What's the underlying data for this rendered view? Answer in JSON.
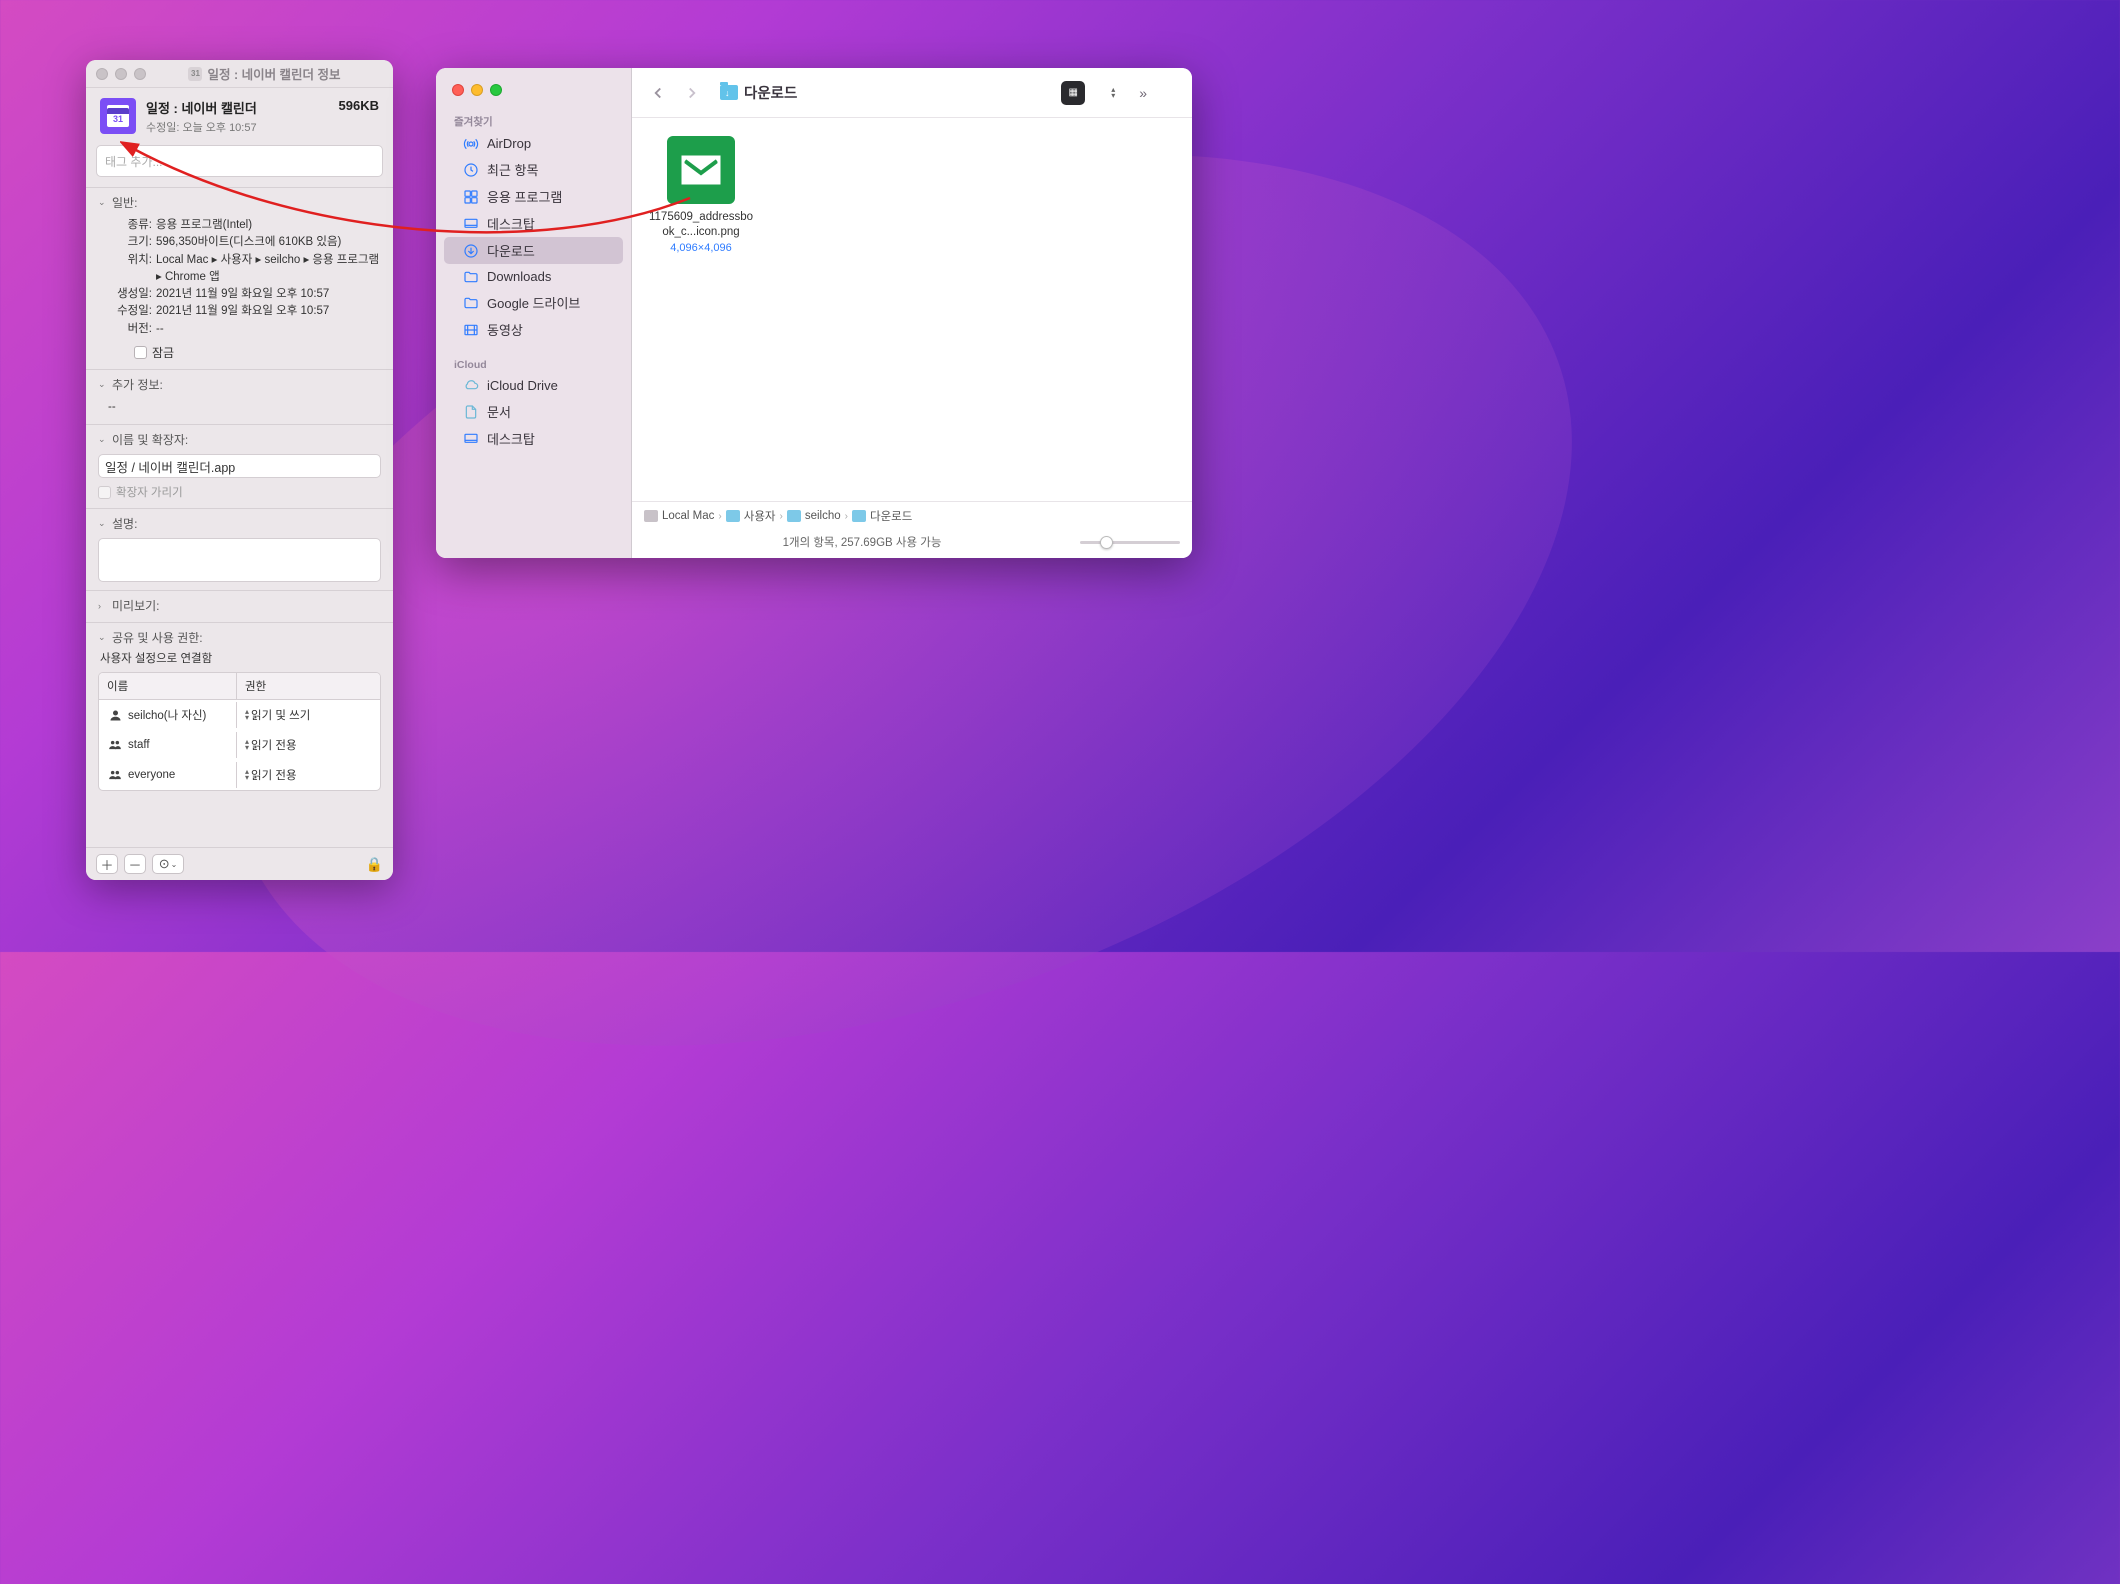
{
  "info": {
    "window_title": "일정 : 네이버 캘린더 정보",
    "app_name": "일정 : 네이버 캘린더",
    "modified_label": "수정일: 오늘 오후 10:57",
    "size": "596KB",
    "tag_placeholder": "태그 추가...",
    "icon_day": "31",
    "sections": {
      "general": {
        "title": "일반:",
        "kind_label": "종류:",
        "kind": "응용 프로그램(Intel)",
        "size_label": "크기:",
        "size": "596,350바이트(디스크에 610KB 있음)",
        "where_label": "위치:",
        "where": "Local Mac ▸ 사용자 ▸ seilcho ▸ 응용 프로그램 ▸ Chrome 앱",
        "created_label": "생성일:",
        "created": "2021년 11월 9일 화요일 오후 10:57",
        "modified_label": "수정일:",
        "modified": "2021년 11월 9일 화요일 오후 10:57",
        "version_label": "버전:",
        "version": "--",
        "locked_label": "잠금"
      },
      "more": {
        "title": "추가 정보:",
        "content": "--"
      },
      "name_ext": {
        "title": "이름 및 확장자:",
        "value": "일정 / 네이버 캘린더.app",
        "hide_ext": "확장자 가리기"
      },
      "comments": {
        "title": "설명:"
      },
      "preview": {
        "title": "미리보기:"
      },
      "sharing": {
        "title": "공유 및 사용 권한:",
        "note": "사용자 설정으로 연결함",
        "col_name": "이름",
        "col_priv": "권한",
        "rows": [
          {
            "user": "seilcho(나 자신)",
            "priv": "읽기 및 쓰기",
            "icon": "person"
          },
          {
            "user": "staff",
            "priv": "읽기 전용",
            "icon": "group"
          },
          {
            "user": "everyone",
            "priv": "읽기 전용",
            "icon": "group"
          }
        ]
      }
    }
  },
  "finder": {
    "location_title": "다운로드",
    "sidebar": {
      "favorites_label": "즐겨찾기",
      "favorites": [
        {
          "label": "AirDrop",
          "icon": "airdrop"
        },
        {
          "label": "최근 항목",
          "icon": "clock"
        },
        {
          "label": "응용 프로그램",
          "icon": "apps"
        },
        {
          "label": "데스크탑",
          "icon": "desktop"
        },
        {
          "label": "다운로드",
          "icon": "download",
          "selected": true
        },
        {
          "label": "Downloads",
          "icon": "folder"
        },
        {
          "label": "Google 드라이브",
          "icon": "folder"
        },
        {
          "label": "동영상",
          "icon": "movie"
        }
      ],
      "icloud_label": "iCloud",
      "icloud": [
        {
          "label": "iCloud Drive",
          "icon": "cloud"
        },
        {
          "label": "문서",
          "icon": "doc"
        },
        {
          "label": "데스크탑",
          "icon": "desktop"
        }
      ]
    },
    "file": {
      "name": "1175609_addressbook_c...icon.png",
      "dimensions": "4,096×4,096"
    },
    "path": [
      "Local Mac",
      "사용자",
      "seilcho",
      "다운로드"
    ],
    "status": "1개의 항목, 257.69GB 사용 가능"
  }
}
